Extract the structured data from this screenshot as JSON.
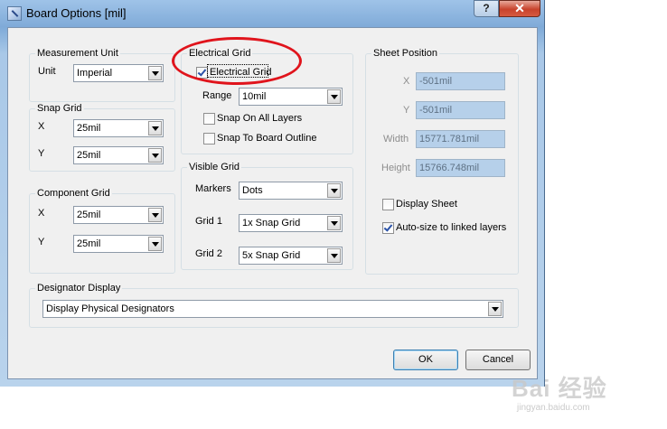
{
  "window": {
    "title": "Board Options [mil]",
    "help_label": "?",
    "close_label": "✕"
  },
  "measurement_unit": {
    "legend": "Measurement Unit",
    "unit_label": "Unit",
    "unit_value": "Imperial"
  },
  "snap_grid": {
    "legend": "Snap Grid",
    "x_label": "X",
    "x_value": "25mil",
    "y_label": "Y",
    "y_value": "25mil"
  },
  "component_grid": {
    "legend": "Component Grid",
    "x_label": "X",
    "x_value": "25mil",
    "y_label": "Y",
    "y_value": "25mil"
  },
  "electrical_grid": {
    "legend": "Electrical Grid",
    "enable_label": "Electrical Grid",
    "enable_checked": true,
    "range_label": "Range",
    "range_value": "10mil",
    "snap_all_layers_label": "Snap On All Layers",
    "snap_all_layers_checked": false,
    "snap_board_outline_label": "Snap To Board Outline",
    "snap_board_outline_checked": false
  },
  "visible_grid": {
    "legend": "Visible Grid",
    "markers_label": "Markers",
    "markers_value": "Dots",
    "grid1_label": "Grid 1",
    "grid1_value": "1x Snap Grid",
    "grid2_label": "Grid 2",
    "grid2_value": "5x Snap Grid"
  },
  "sheet_position": {
    "legend": "Sheet Position",
    "x_label": "X",
    "x_value": "-501mil",
    "y_label": "Y",
    "y_value": "-501mil",
    "width_label": "Width",
    "width_value": "15771.781mil",
    "height_label": "Height",
    "height_value": "15766.748mil",
    "display_sheet_label": "Display Sheet",
    "display_sheet_checked": false,
    "autosize_label": "Auto-size to linked layers",
    "autosize_checked": true
  },
  "designator_display": {
    "legend": "Designator Display",
    "value": "Display Physical Designators"
  },
  "buttons": {
    "ok_label": "OK",
    "cancel_label": "Cancel"
  },
  "watermark": {
    "main": "Bai 经验",
    "sub": "jingyan.baidu.com"
  },
  "colors": {
    "annotation_circle": "#e0141c",
    "disabled_field_bg": "#b6d0ea"
  }
}
